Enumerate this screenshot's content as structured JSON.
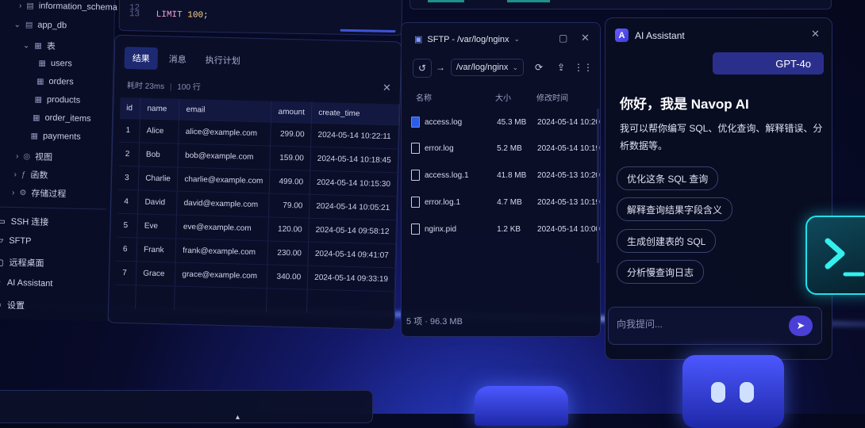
{
  "sidebar": {
    "tree": [
      {
        "label": "information_schema",
        "icon": "database-icon"
      },
      {
        "label": "app_db",
        "icon": "database-icon"
      },
      {
        "label": "表",
        "icon": "table-group-icon"
      },
      {
        "label": "users",
        "icon": "table-icon"
      },
      {
        "label": "orders",
        "icon": "table-icon"
      },
      {
        "label": "products",
        "icon": "table-icon"
      },
      {
        "label": "order_items",
        "icon": "table-icon"
      },
      {
        "label": "payments",
        "icon": "table-icon"
      },
      {
        "label": "视图",
        "icon": "view-icon"
      },
      {
        "label": "函数",
        "icon": "function-icon"
      },
      {
        "label": "存储过程",
        "icon": "procedure-icon"
      }
    ],
    "nav": [
      {
        "label": "SSH 连接",
        "icon": "ssh-icon"
      },
      {
        "label": "SFTP",
        "icon": "folder-icon"
      },
      {
        "label": "远程桌面",
        "icon": "monitor-icon"
      },
      {
        "label": "AI Assistant",
        "icon": "sparkle-icon"
      },
      {
        "label": "设置",
        "icon": "gear-icon"
      }
    ]
  },
  "editor": {
    "lines": [
      {
        "no": "12",
        "code": ""
      },
      {
        "no": "13",
        "keyword": "LIMIT",
        "number": "100",
        "tail": ";"
      }
    ]
  },
  "results": {
    "tabs": [
      "结果",
      "消息",
      "执行计划"
    ],
    "active_tab": 0,
    "time_label": "耗时",
    "time_value": "23ms",
    "rows_label": "100 行",
    "columns": [
      "id",
      "name",
      "email",
      "amount",
      "create_time"
    ],
    "rows": [
      [
        "1",
        "Alice",
        "alice@example.com",
        "299.00",
        "2024-05-14 10:22:11"
      ],
      [
        "2",
        "Bob",
        "bob@example.com",
        "159.00",
        "2024-05-14 10:18:45"
      ],
      [
        "3",
        "Charlie",
        "charlie@example.com",
        "499.00",
        "2024-05-14 10:15:30"
      ],
      [
        "4",
        "David",
        "david@example.com",
        "79.00",
        "2024-05-14 10:05:21"
      ],
      [
        "5",
        "Eve",
        "eve@example.com",
        "120.00",
        "2024-05-14 09:58:12"
      ],
      [
        "6",
        "Frank",
        "frank@example.com",
        "230.00",
        "2024-05-14 09:41:07"
      ],
      [
        "7",
        "Grace",
        "grace@example.com",
        "340.00",
        "2024-05-14 09:33:19"
      ]
    ]
  },
  "sftp": {
    "title": "SFTP - /var/log/nginx",
    "path": "/var/log/nginx",
    "columns": [
      "名称",
      "大小",
      "修改时间"
    ],
    "files": [
      {
        "name": "access.log",
        "size": "45.3 MB",
        "modified": "2024-05-14 10:20",
        "icon": "file-blue-icon"
      },
      {
        "name": "error.log",
        "size": "5.2 MB",
        "modified": "2024-05-14 10:19",
        "icon": "file-icon"
      },
      {
        "name": "access.log.1",
        "size": "41.8 MB",
        "modified": "2024-05-13 10:20",
        "icon": "file-icon"
      },
      {
        "name": "error.log.1",
        "size": "4.7 MB",
        "modified": "2024-05-13 10:19",
        "icon": "file-icon"
      },
      {
        "name": "nginx.pid",
        "size": "1.2 KB",
        "modified": "2024-05-14 10:00",
        "icon": "file-icon"
      }
    ],
    "footer": "5 项 · 96.3 MB"
  },
  "ai": {
    "title": "AI Assistant",
    "logo_letter": "A",
    "model": "GPT-4o",
    "greeting": "你好，我是 Navop AI",
    "description": "我可以帮你编写 SQL、优化查询、解释错误、分析数据等。",
    "suggestions": [
      "优化这条 SQL 查询",
      "解释查询结果字段含义",
      "生成创建表的 SQL",
      "分析慢查询日志"
    ],
    "input_placeholder": "向我提问..."
  },
  "colors": {
    "accent": "#4a3fd6",
    "cyan": "#22e0e6",
    "background": "#080b2a"
  }
}
